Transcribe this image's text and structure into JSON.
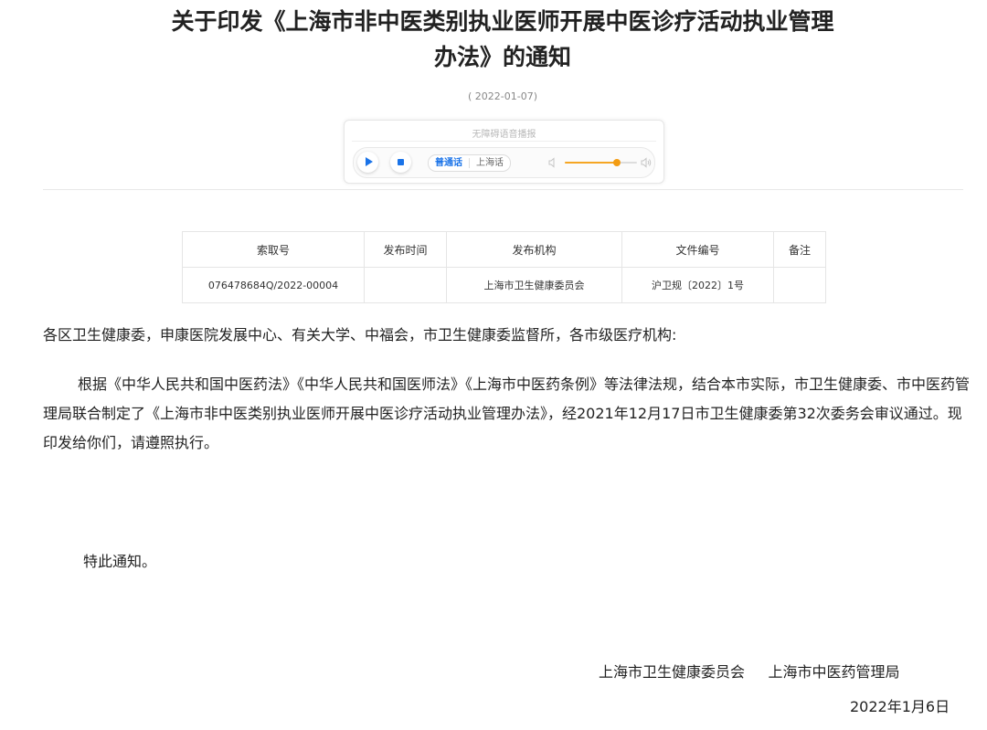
{
  "document": {
    "title_line1": "关于印发《上海市非中医类别执业医师开展中医诊疗活动执业管理",
    "title_line2": "办法》的通知",
    "publish_date": "( 2022-01-07)"
  },
  "audio_player": {
    "caption": "无障碍语音播报",
    "language_options": [
      "普通话",
      "上海话"
    ],
    "selected_language": "普通话",
    "volume_fraction": 0.72,
    "accent_color": "#1a73e8",
    "volume_color": "#f39c12",
    "icons": [
      "play-icon",
      "stop-icon",
      "volume-low-icon",
      "volume-high-icon"
    ]
  },
  "meta_table": {
    "headers": [
      "索取号",
      "发布时间",
      "发布机构",
      "文件编号",
      "备注"
    ],
    "rows": [
      [
        "076478684Q/2022-00004",
        "",
        "上海市卫生健康委员会",
        "沪卫规〔2022〕1号",
        ""
      ]
    ]
  },
  "content": {
    "greeting": "各区卫生健康委，申康医院发展中心、有关大学、中福会，市卫生健康委监督所，各市级医疗机构:",
    "body": "根据《中华人民共和国中医药法》《中华人民共和国医师法》《上海市中医药条例》等法律法规，结合本市实际，市卫生健康委、市中医药管理局联合制定了《上海市非中医类别执业医师开展中医诊疗活动执业管理办法》，经2021年12月17日市卫生健康委第32次委务会审议通过。现印发给你们，请遵照执行。",
    "closing": "特此通知。",
    "signature_org1": "上海市卫生健康委员会",
    "signature_org2": "上海市中医药管理局",
    "signature_date": "2022年1月6日"
  }
}
